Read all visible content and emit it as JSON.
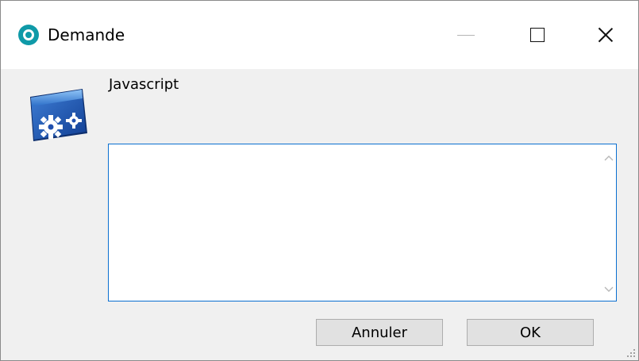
{
  "window": {
    "title": "Demande",
    "app_icon": "app-icon",
    "controls": {
      "minimize_icon": "minimize-icon",
      "maximize_icon": "maximize-icon",
      "close_icon": "close-icon"
    }
  },
  "dialog": {
    "icon": "script-gear-icon",
    "prompt_label": "Javascript",
    "input_value": "",
    "cancel_label": "Annuler",
    "ok_label": "OK"
  },
  "colors": {
    "accent": "#0a6fd0",
    "app_icon": "#0f9aa8",
    "window_bg": "#f0f0f0",
    "button_bg": "#e1e1e1"
  }
}
